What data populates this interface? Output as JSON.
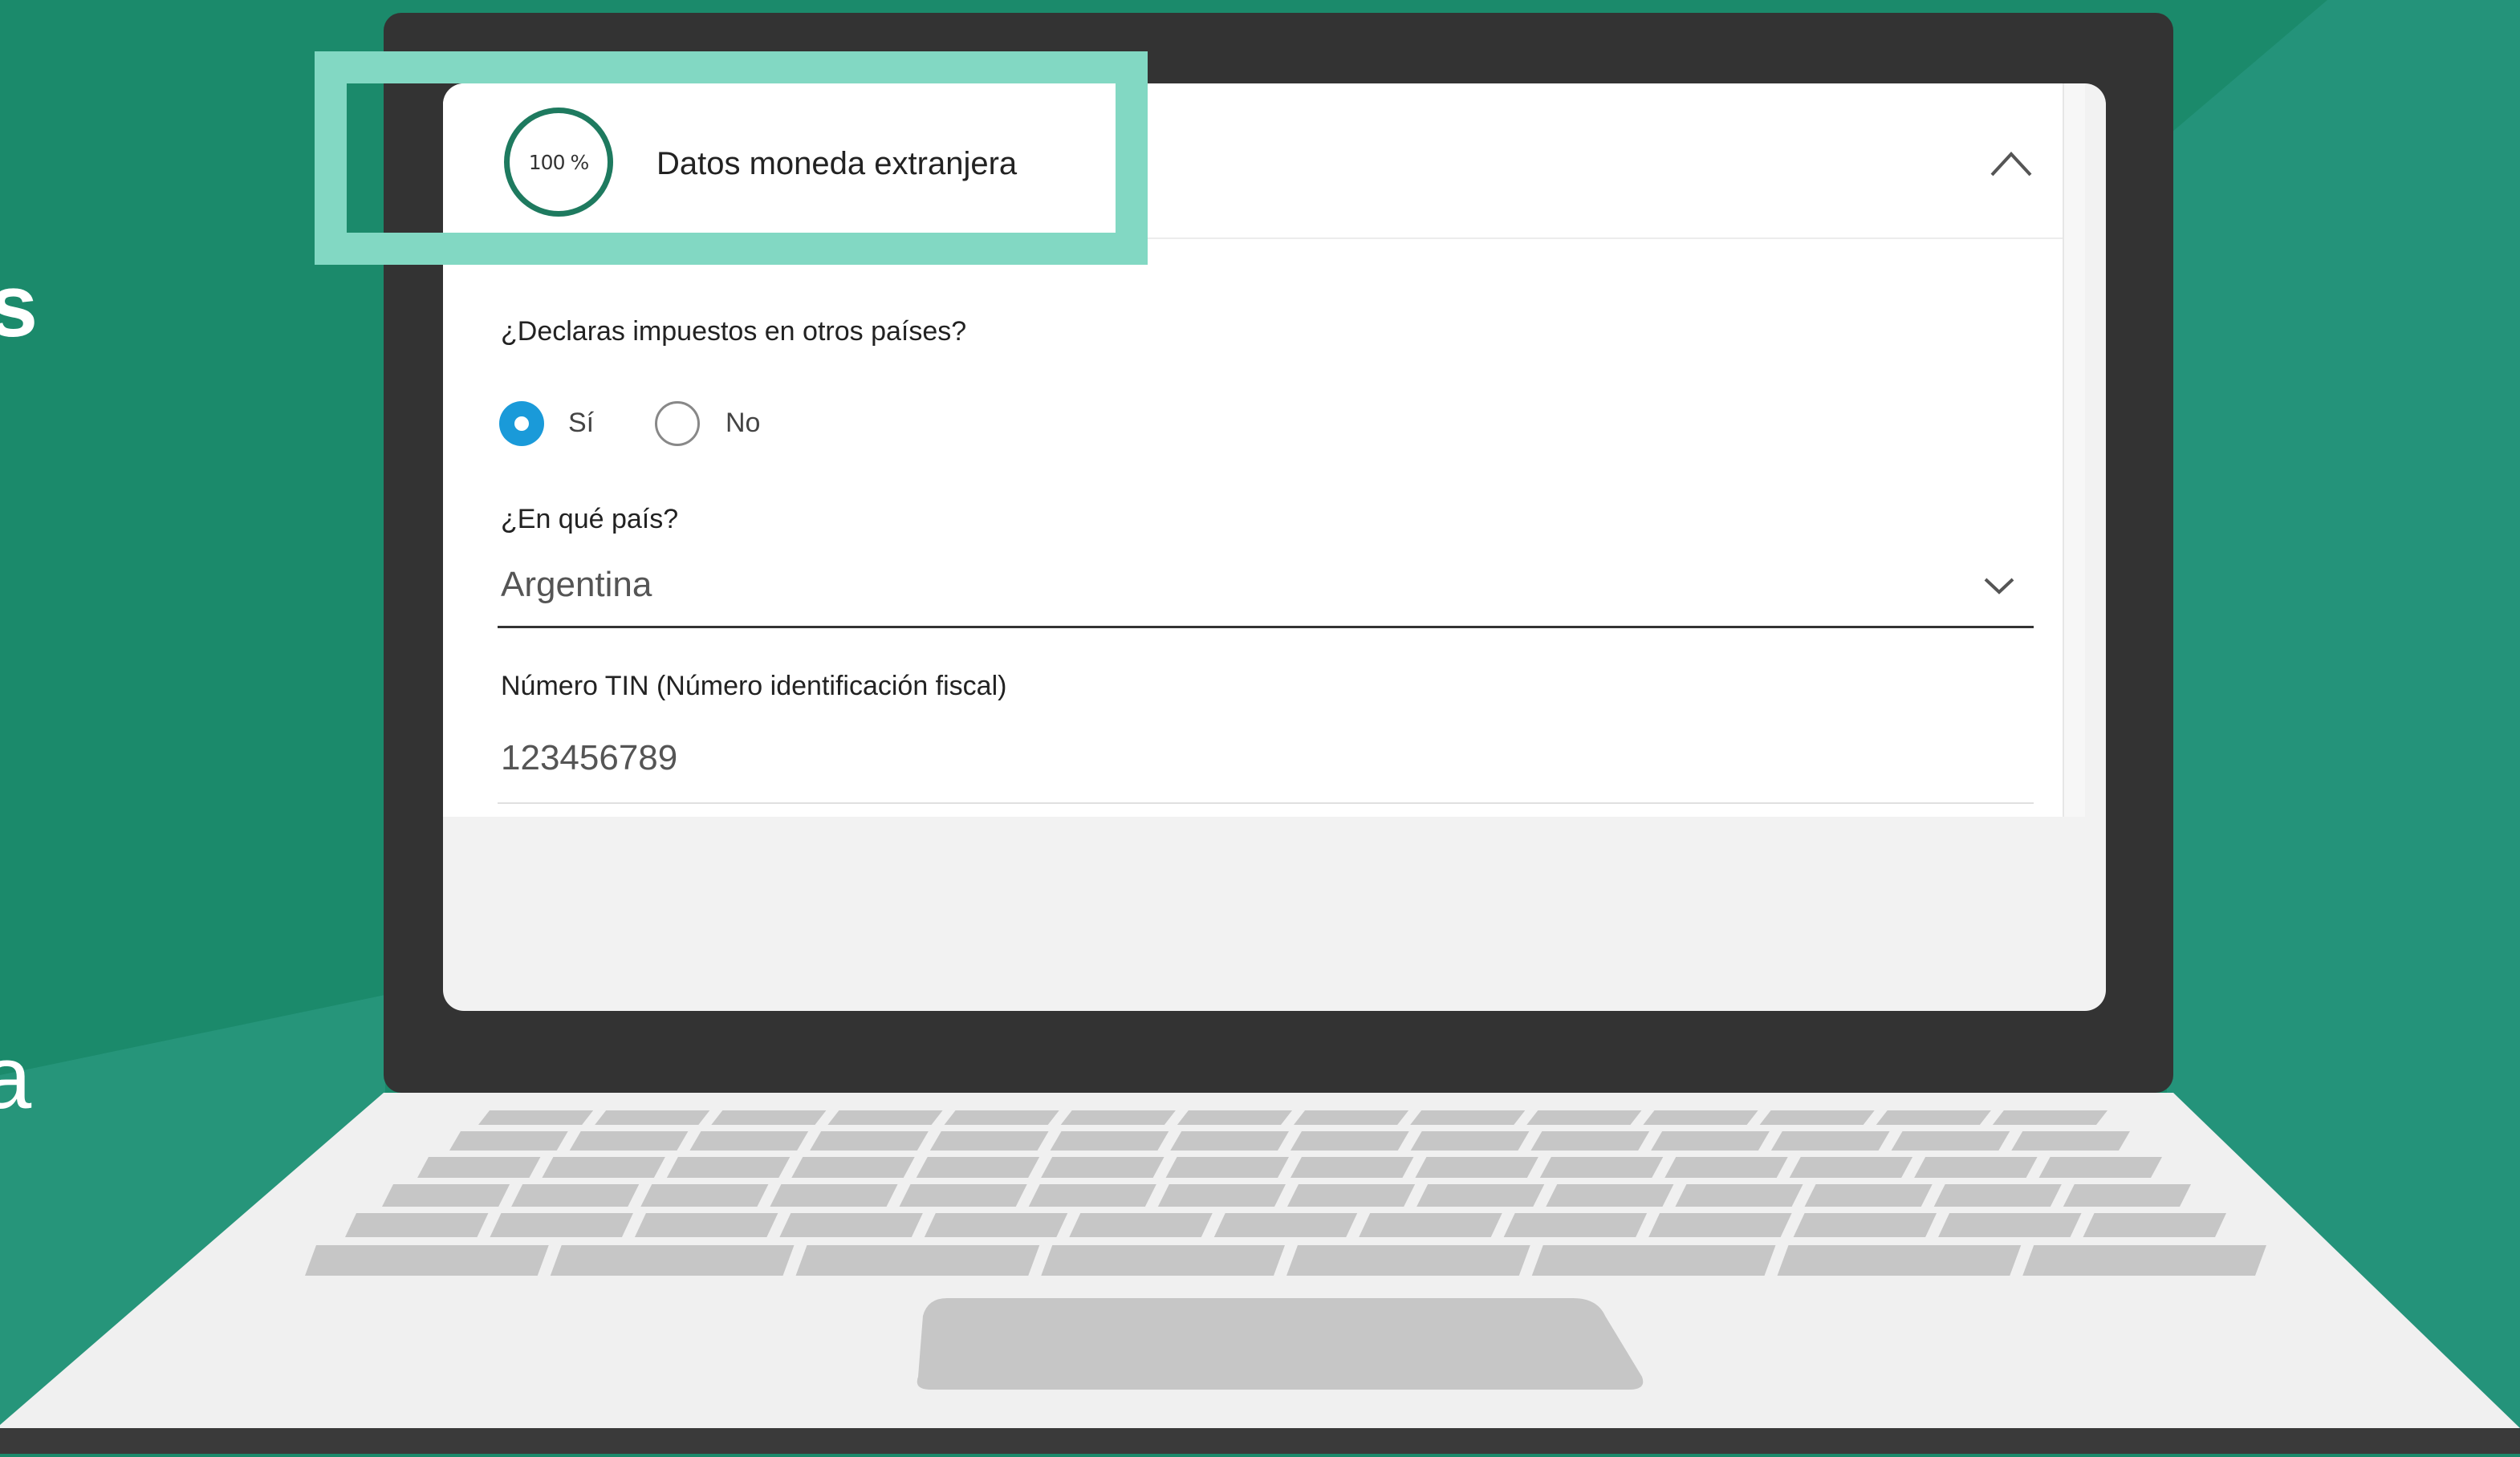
{
  "colors": {
    "background": "#1b8a6b",
    "highlight": "#82d8c3",
    "radio_selected": "#1a9ad9",
    "progress_ring": "#1e7a5f",
    "laptop_bezel": "#333333",
    "keyboard_keys": "#c6c6c6"
  },
  "section": {
    "progress_label": "100 %",
    "progress_value": 1.0,
    "title": "Datos moneda extranjera",
    "collapse_icon": "chevron-up-icon"
  },
  "form": {
    "taxes_question": "¿Declaras impuestos en otros países?",
    "options": [
      {
        "label": "Sí",
        "selected": true
      },
      {
        "label": "No",
        "selected": false
      }
    ],
    "country_label": "¿En qué país?",
    "country_value": "Argentina",
    "country_icon": "chevron-down-icon",
    "tin_label": "Número TIN (Número identificación fiscal)",
    "tin_value": "123456789"
  },
  "edge_text": {
    "top": "s",
    "bottom": "a"
  }
}
